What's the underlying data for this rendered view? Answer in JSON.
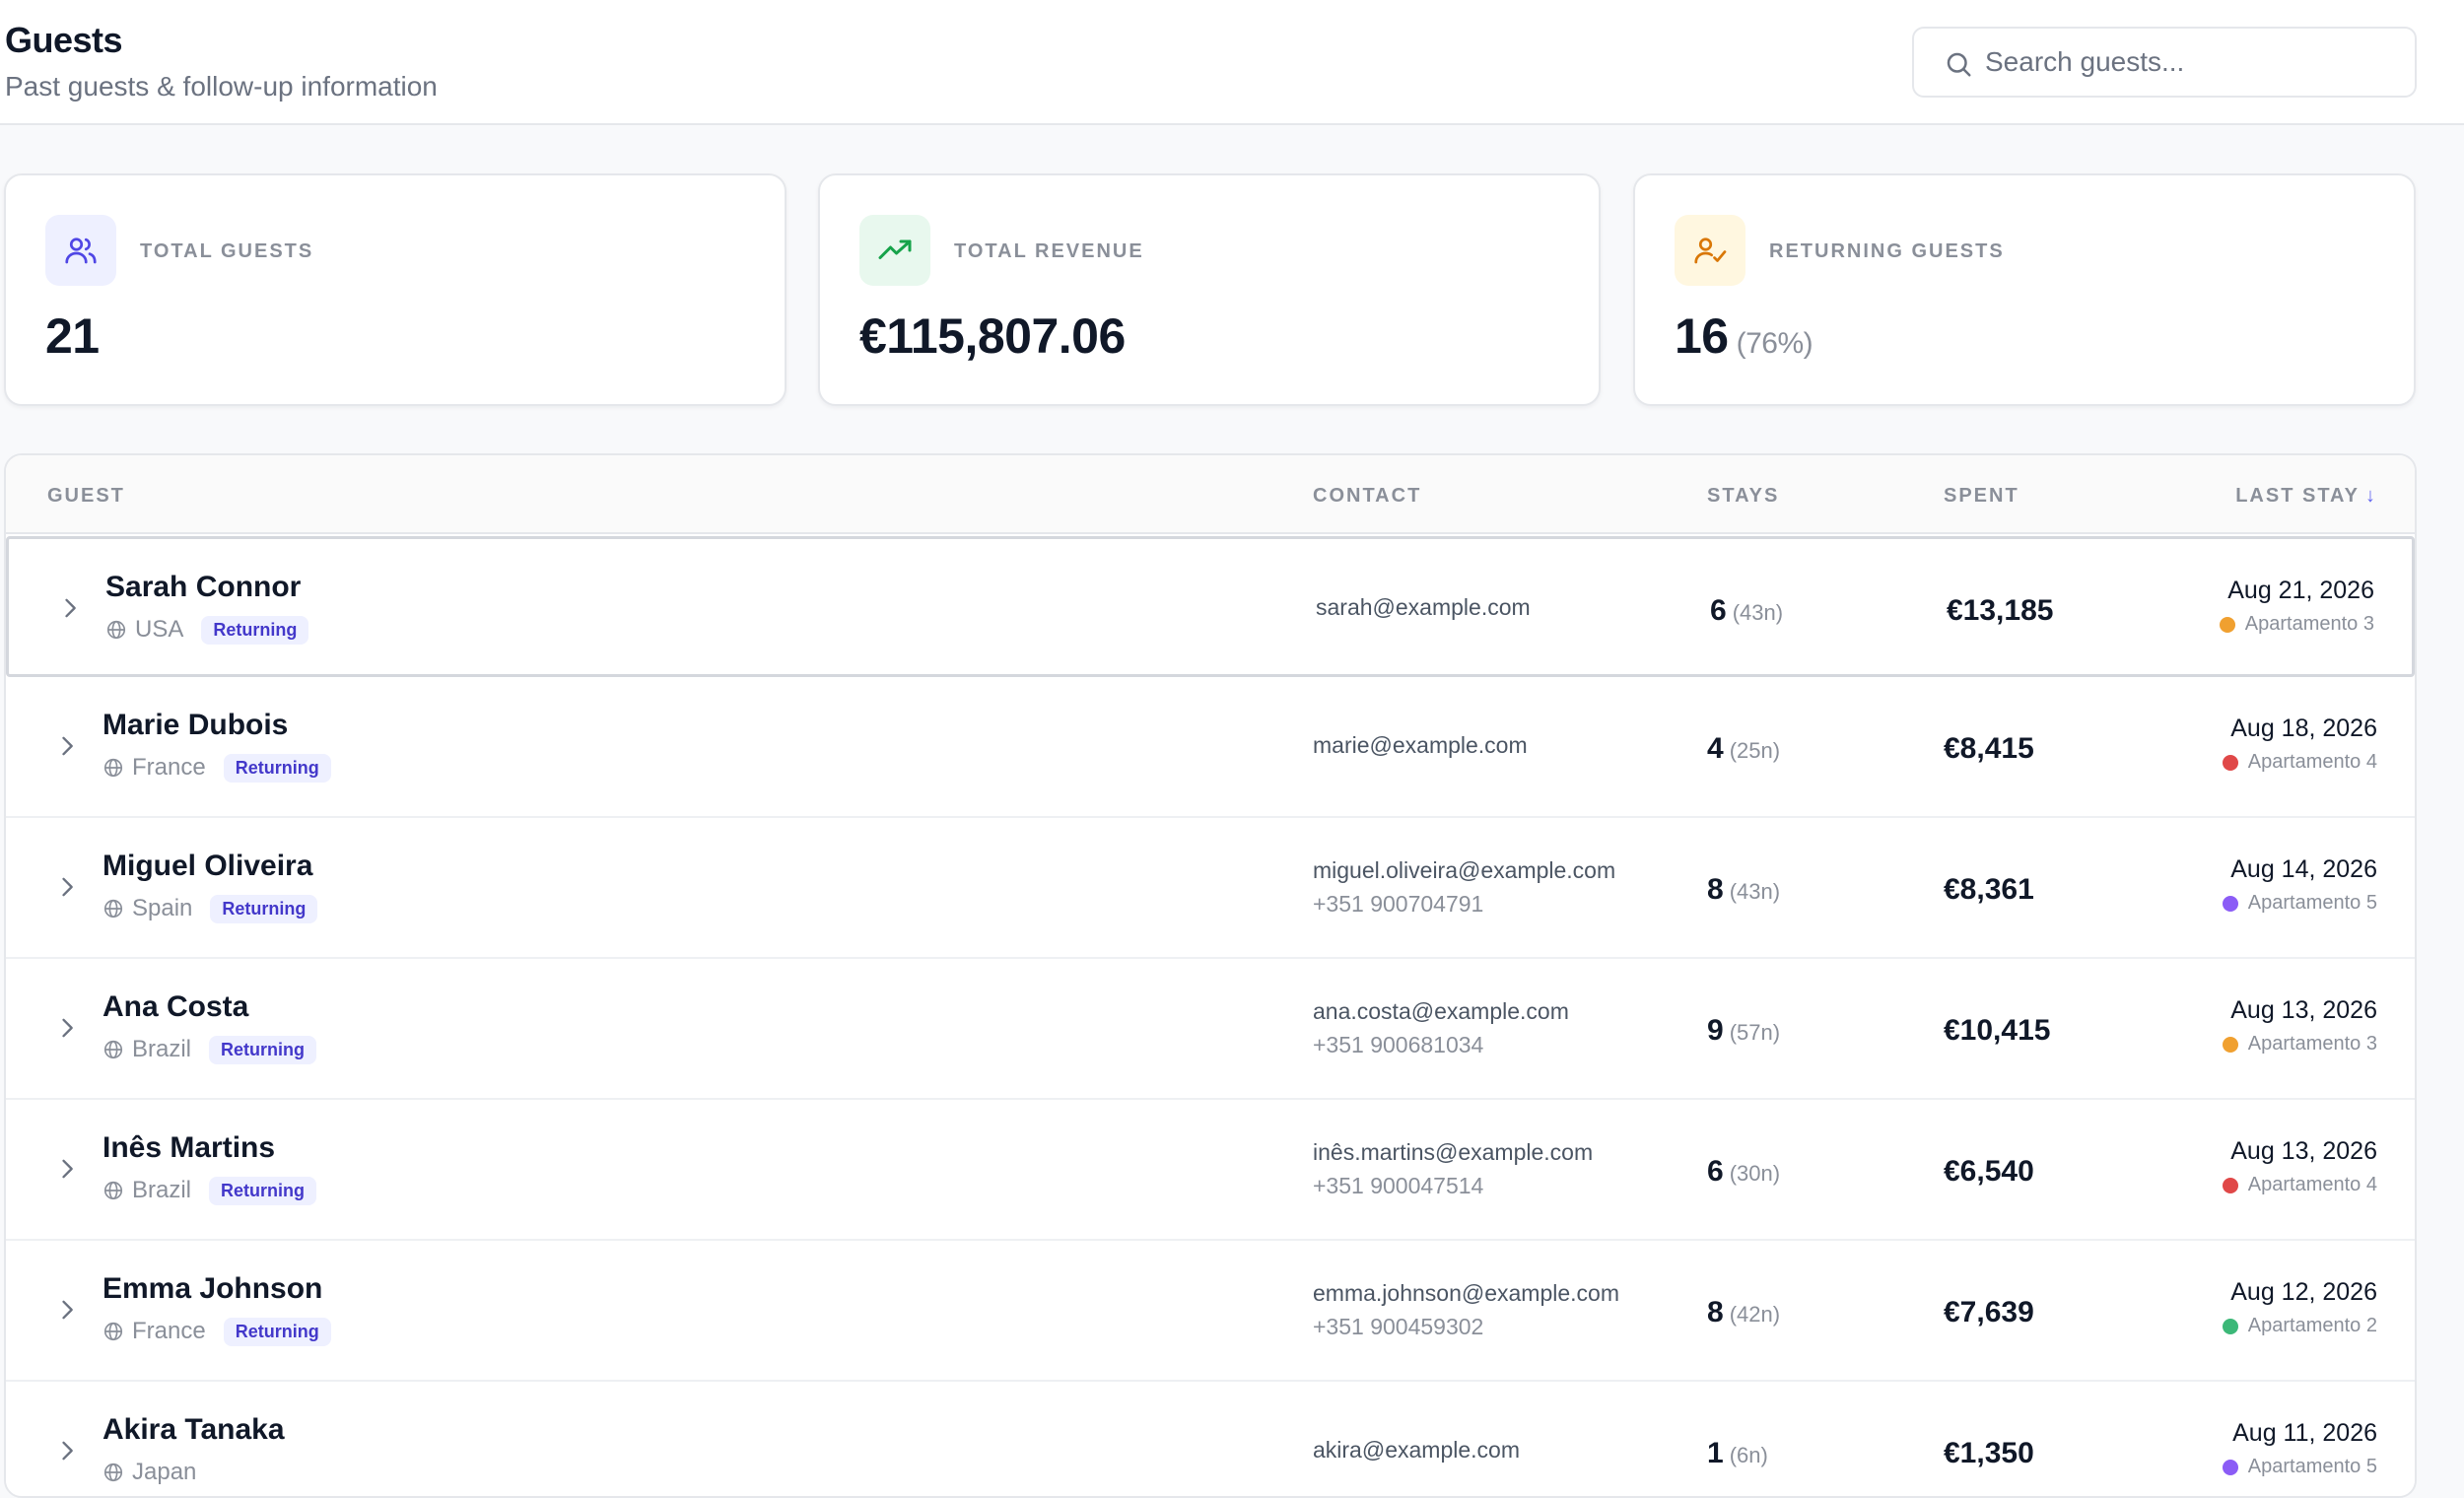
{
  "header": {
    "title": "Guests",
    "subtitle": "Past guests & follow-up information",
    "search_placeholder": "Search guests..."
  },
  "stats": [
    {
      "label": "TOTAL GUESTS",
      "value": "21",
      "sub": "",
      "icon": "users-icon",
      "icon_bg": "#eef0ff",
      "icon_color": "#4f46e5"
    },
    {
      "label": "TOTAL REVENUE",
      "value": "€115,807.06",
      "sub": "",
      "icon": "trending-up-icon",
      "icon_bg": "#e8f8ee",
      "icon_color": "#16a34a"
    },
    {
      "label": "RETURNING GUESTS",
      "value": "16",
      "sub": "(76%)",
      "icon": "user-check-icon",
      "icon_bg": "#fff7e0",
      "icon_color": "#d97706"
    }
  ],
  "table": {
    "columns": {
      "guest": "GUEST",
      "contact": "CONTACT",
      "stays": "STAYS",
      "spent": "SPENT",
      "last_stay": "LAST STAY",
      "sort_arrow": "↓"
    },
    "rows": [
      {
        "name": "Sarah Connor",
        "country": "USA",
        "badge": "Returning",
        "email": "sarah@example.com",
        "phone": "",
        "stays": "6",
        "nights": "(43n)",
        "spent": "€13,185",
        "date": "Aug 21, 2026",
        "apartment": "Apartamento 3",
        "apt_color": "#f0a030"
      },
      {
        "name": "Marie Dubois",
        "country": "France",
        "badge": "Returning",
        "email": "marie@example.com",
        "phone": "",
        "stays": "4",
        "nights": "(25n)",
        "spent": "€8,415",
        "date": "Aug 18, 2026",
        "apartment": "Apartamento 4",
        "apt_color": "#e04848"
      },
      {
        "name": "Miguel Oliveira",
        "country": "Spain",
        "badge": "Returning",
        "email": "miguel.oliveira@example.com",
        "phone": "+351 900704791",
        "stays": "8",
        "nights": "(43n)",
        "spent": "€8,361",
        "date": "Aug 14, 2026",
        "apartment": "Apartamento 5",
        "apt_color": "#8b5cf6"
      },
      {
        "name": "Ana Costa",
        "country": "Brazil",
        "badge": "Returning",
        "email": "ana.costa@example.com",
        "phone": "+351 900681034",
        "stays": "9",
        "nights": "(57n)",
        "spent": "€10,415",
        "date": "Aug 13, 2026",
        "apartment": "Apartamento 3",
        "apt_color": "#f0a030"
      },
      {
        "name": "Inês Martins",
        "country": "Brazil",
        "badge": "Returning",
        "email": "inês.martins@example.com",
        "phone": "+351 900047514",
        "stays": "6",
        "nights": "(30n)",
        "spent": "€6,540",
        "date": "Aug 13, 2026",
        "apartment": "Apartamento 4",
        "apt_color": "#e04848"
      },
      {
        "name": "Emma Johnson",
        "country": "France",
        "badge": "Returning",
        "email": "emma.johnson@example.com",
        "phone": "+351 900459302",
        "stays": "8",
        "nights": "(42n)",
        "spent": "€7,639",
        "date": "Aug 12, 2026",
        "apartment": "Apartamento 2",
        "apt_color": "#3cb878"
      },
      {
        "name": "Akira Tanaka",
        "country": "Japan",
        "badge": "",
        "email": "akira@example.com",
        "phone": "",
        "stays": "1",
        "nights": "(6n)",
        "spent": "€1,350",
        "date": "Aug 11, 2026",
        "apartment": "Apartamento 5",
        "apt_color": "#8b5cf6"
      }
    ]
  }
}
